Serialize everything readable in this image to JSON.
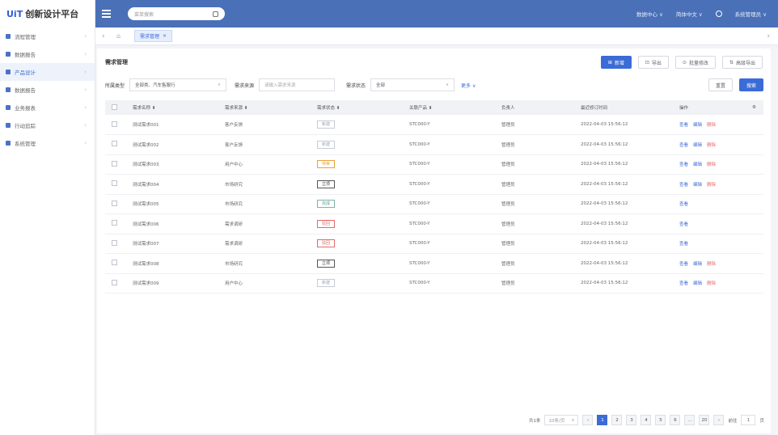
{
  "brand": {
    "logo": "UiT",
    "name": "创新设计平台"
  },
  "sidebar": {
    "items": [
      {
        "label": "流程管理",
        "active": false
      },
      {
        "label": "数据报告",
        "active": false
      },
      {
        "label": "产品设计",
        "active": true
      },
      {
        "label": "数据报告",
        "active": false
      },
      {
        "label": "业务报表",
        "active": false
      },
      {
        "label": "行动追踪",
        "active": false
      },
      {
        "label": "系统管理",
        "active": false
      }
    ]
  },
  "header": {
    "search_placeholder": "菜单搜索",
    "menu1": "数据中心 ∨",
    "menu2": "简体中文 ∨",
    "user": "系统管理员 ∨"
  },
  "tabs": {
    "active_tab": "需求管理",
    "close": "×"
  },
  "page": {
    "title": "需求管理",
    "actions": {
      "new": "新增",
      "import": "导出",
      "batch": "批量修改",
      "export": "高级导出"
    }
  },
  "filters": {
    "type_label": "所属类型",
    "type_value": "全部类、汽车售服行",
    "source_label": "需求来源",
    "source_placeholder": "请输入需求来源",
    "status_label": "需求状态",
    "status_value": "全部",
    "more": "更多 ∨",
    "reset": "重置",
    "search": "搜索"
  },
  "table": {
    "columns": [
      "需求名称 ⬍",
      "需求来源 ⬍",
      "需求状态 ⬍",
      "关联产品 ⬍",
      "负责人",
      "最近修订时间",
      "操作",
      "⚙"
    ],
    "rows": [
      {
        "name": "测试需求001",
        "source": "客户反馈",
        "status": "新建",
        "status_class": "st-new",
        "product": "STC000-Y",
        "owner": "管理员",
        "time": "2022-04-03 15:56:12",
        "ops": [
          "查看",
          "编辑",
          "删除"
        ]
      },
      {
        "name": "测试需求002",
        "source": "客户反馈",
        "status": "新建",
        "status_class": "st-new",
        "product": "STC000-Y",
        "owner": "管理员",
        "time": "2022-04-03 15:56:12",
        "ops": [
          "查看",
          "编辑",
          "删除"
        ]
      },
      {
        "name": "测试需求003",
        "source": "用户中心",
        "status": "待审",
        "status_class": "st-pend",
        "product": "STC000-Y",
        "owner": "管理员",
        "time": "2022-04-03 15:56:12",
        "ops": [
          "查看",
          "编辑",
          "删除"
        ]
      },
      {
        "name": "测试需求004",
        "source": "市场研究",
        "status": "立项",
        "status_class": "st-ok",
        "product": "STC000-Y",
        "owner": "管理员",
        "time": "2022-04-03 15:56:12",
        "ops": [
          "查看",
          "编辑",
          "删除"
        ]
      },
      {
        "name": "测试需求005",
        "source": "市场研究",
        "status": "完成",
        "status_class": "st-done",
        "product": "STC000-Y",
        "owner": "管理员",
        "time": "2022-04-03 15:56:12",
        "ops": [
          "查看"
        ]
      },
      {
        "name": "测试需求006",
        "source": "需求调研",
        "status": "驳回",
        "status_class": "st-reject",
        "product": "STC000-Y",
        "owner": "管理员",
        "time": "2022-04-03 15:56:12",
        "ops": [
          "查看"
        ]
      },
      {
        "name": "测试需求007",
        "source": "需求调研",
        "status": "驳回",
        "status_class": "st-reject",
        "product": "STC000-Y",
        "owner": "管理员",
        "time": "2022-04-03 15:56:12",
        "ops": [
          "查看"
        ]
      },
      {
        "name": "测试需求008",
        "source": "市场研究",
        "status": "立项",
        "status_class": "st-ok",
        "product": "STC000-Y",
        "owner": "管理员",
        "time": "2022-04-03 15:56:12",
        "ops": [
          "查看",
          "编辑",
          "删除"
        ]
      },
      {
        "name": "测试需求009",
        "source": "用户中心",
        "status": "新建",
        "status_class": "st-new",
        "product": "STC000-Y",
        "owner": "管理员",
        "time": "2022-04-03 15:56:12",
        "ops": [
          "查看",
          "编辑",
          "删除"
        ]
      }
    ]
  },
  "pager": {
    "total": "共1条",
    "page_size": "10条/页",
    "pages": [
      "1",
      "2",
      "3",
      "4",
      "5",
      "6",
      "…",
      "20"
    ],
    "current": "1",
    "goto_label": "前往",
    "goto_value": "1",
    "goto_suffix": "页"
  }
}
